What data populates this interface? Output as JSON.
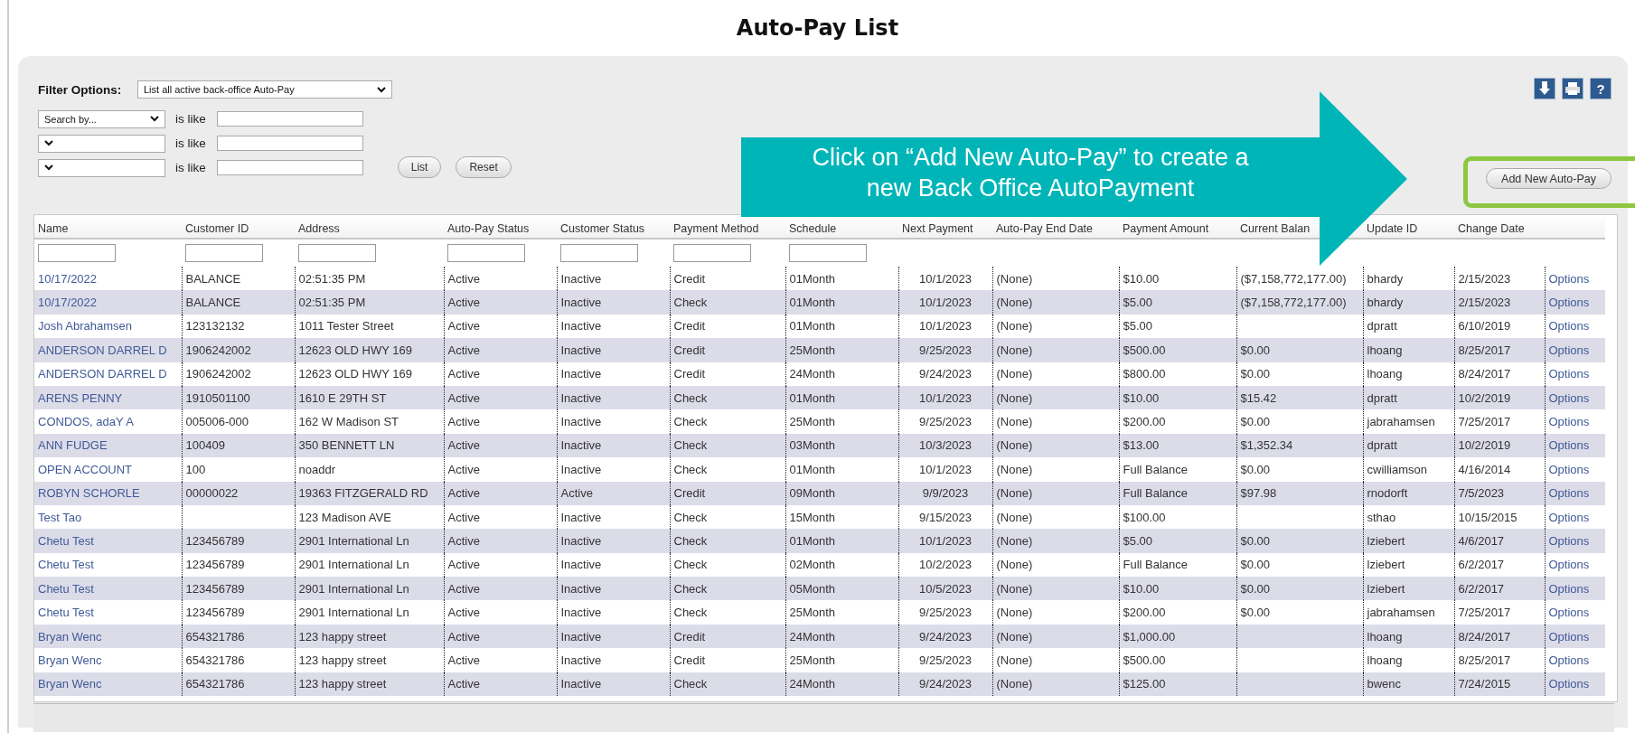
{
  "title": "Auto-Pay List",
  "filter": {
    "label": "Filter Options:",
    "value": "List all active back-office Auto-Pay"
  },
  "search_rows": [
    {
      "field": "Search by...",
      "operator": "is like"
    },
    {
      "operator": "is like"
    },
    {
      "operator": "is like"
    }
  ],
  "buttons": [
    "List",
    "Reset"
  ],
  "toolbar": {
    "help": "?"
  },
  "add_button": "Add New Auto-Pay",
  "callout": {
    "lines": [
      "Click on “Add New Auto-Pay” to create a",
      "new Back Office AutoPayment"
    ]
  },
  "table": {
    "columns": [
      {
        "label": "Name",
        "has_filter": true
      },
      {
        "label": "Customer ID",
        "has_filter": true
      },
      {
        "label": "Address",
        "has_filter": true
      },
      {
        "label": "Auto-Pay Status",
        "has_filter": true
      },
      {
        "label": "Customer Status",
        "has_filter": true
      },
      {
        "label": "Payment Method",
        "has_filter": true
      },
      {
        "label": "Schedule",
        "has_filter": true
      },
      {
        "label": "Next Payment",
        "has_filter": false
      },
      {
        "label": "Auto-Pay End Date",
        "has_filter": false
      },
      {
        "label": "Payment Amount",
        "has_filter": false
      },
      {
        "label": "Current Balan",
        "has_filter": false
      },
      {
        "label": "Update ID",
        "has_filter": false
      },
      {
        "label": "Change Date",
        "has_filter": false
      }
    ],
    "rows": [
      [
        "10/17/2022",
        "BALANCE",
        "02:51:35 PM",
        "Active",
        "Inactive",
        "Credit",
        "01Month",
        "10/1/2023",
        "(None)",
        "$10.00",
        "($7,158,772,177.00)",
        "bhardy",
        "2/15/2023",
        "Options"
      ],
      [
        "10/17/2022",
        "BALANCE",
        "02:51:35 PM",
        "Active",
        "Inactive",
        "Check",
        "01Month",
        "10/1/2023",
        "(None)",
        "$5.00",
        "($7,158,772,177.00)",
        "bhardy",
        "2/15/2023",
        "Options"
      ],
      [
        "Josh Abrahamsen",
        "123132132",
        "1011 Tester Street",
        "Active",
        "Inactive",
        "Credit",
        "01Month",
        "10/1/2023",
        "(None)",
        "$5.00",
        "",
        "dpratt",
        "6/10/2019",
        "Options"
      ],
      [
        "ANDERSON DARREL D",
        "1906242002",
        "12623 OLD HWY 169",
        "Active",
        "Inactive",
        "Credit",
        "25Month",
        "9/25/2023",
        "(None)",
        "$500.00",
        "$0.00",
        "lhoang",
        "8/25/2017",
        "Options"
      ],
      [
        "ANDERSON DARREL D",
        "1906242002",
        "12623 OLD HWY 169",
        "Active",
        "Inactive",
        "Credit",
        "24Month",
        "9/24/2023",
        "(None)",
        "$800.00",
        "$0.00",
        "lhoang",
        "8/24/2017",
        "Options"
      ],
      [
        "ARENS PENNY",
        "1910501100",
        "1610 E 29TH ST",
        "Active",
        "Inactive",
        "Check",
        "01Month",
        "10/1/2023",
        "(None)",
        "$10.00",
        "$15.42",
        "dpratt",
        "10/2/2019",
        "Options"
      ],
      [
        "CONDOS, adaY A",
        "005006-000",
        "162 W Madison ST",
        "Active",
        "Inactive",
        "Check",
        "25Month",
        "9/25/2023",
        "(None)",
        "$200.00",
        "$0.00",
        "jabrahamsen",
        "7/25/2017",
        "Options"
      ],
      [
        "ANN FUDGE",
        "100409",
        "350 BENNETT LN",
        "Active",
        "Inactive",
        "Check",
        "03Month",
        "10/3/2023",
        "(None)",
        "$13.00",
        "$1,352.34",
        "dpratt",
        "10/2/2019",
        "Options"
      ],
      [
        "OPEN ACCOUNT",
        "100",
        "noaddr",
        "Active",
        "Inactive",
        "Check",
        "01Month",
        "10/1/2023",
        "(None)",
        "Full Balance",
        "$0.00",
        "cwilliamson",
        "4/16/2014",
        "Options"
      ],
      [
        "ROBYN SCHORLE",
        "00000022",
        "19363 FITZGERALD RD",
        "Active",
        "Active",
        "Credit",
        "09Month",
        "9/9/2023",
        "(None)",
        "Full Balance",
        "$97.98",
        "rnodorft",
        "7/5/2023",
        "Options"
      ],
      [
        "Test Tao",
        "",
        "123 Madison AVE",
        "Active",
        "Inactive",
        "Check",
        "15Month",
        "9/15/2023",
        "(None)",
        "$100.00",
        "",
        "sthao",
        "10/15/2015",
        "Options"
      ],
      [
        "Chetu Test",
        "123456789",
        "2901 International Ln",
        "Active",
        "Inactive",
        "Check",
        "01Month",
        "10/1/2023",
        "(None)",
        "$5.00",
        "$0.00",
        "lziebert",
        "4/6/2017",
        "Options"
      ],
      [
        "Chetu Test",
        "123456789",
        "2901 International Ln",
        "Active",
        "Inactive",
        "Check",
        "02Month",
        "10/2/2023",
        "(None)",
        "Full Balance",
        "$0.00",
        "lziebert",
        "6/2/2017",
        "Options"
      ],
      [
        "Chetu Test",
        "123456789",
        "2901 International Ln",
        "Active",
        "Inactive",
        "Check",
        "05Month",
        "10/5/2023",
        "(None)",
        "$10.00",
        "$0.00",
        "lziebert",
        "6/2/2017",
        "Options"
      ],
      [
        "Chetu Test",
        "123456789",
        "2901 International Ln",
        "Active",
        "Inactive",
        "Check",
        "25Month",
        "9/25/2023",
        "(None)",
        "$200.00",
        "$0.00",
        "jabrahamsen",
        "7/25/2017",
        "Options"
      ],
      [
        "Bryan Wenc",
        "654321786",
        "123 happy street",
        "Active",
        "Inactive",
        "Credit",
        "24Month",
        "9/24/2023",
        "(None)",
        "$1,000.00",
        "",
        "lhoang",
        "8/24/2017",
        "Options"
      ],
      [
        "Bryan Wenc",
        "654321786",
        "123 happy street",
        "Active",
        "Inactive",
        "Credit",
        "25Month",
        "9/25/2023",
        "(None)",
        "$500.00",
        "",
        "lhoang",
        "8/25/2017",
        "Options"
      ],
      [
        "Bryan Wenc",
        "654321786",
        "123 happy street",
        "Active",
        "Inactive",
        "Check",
        "24Month",
        "9/24/2023",
        "(None)",
        "$125.00",
        "",
        "bwenc",
        "7/24/2015",
        "Options"
      ]
    ]
  }
}
